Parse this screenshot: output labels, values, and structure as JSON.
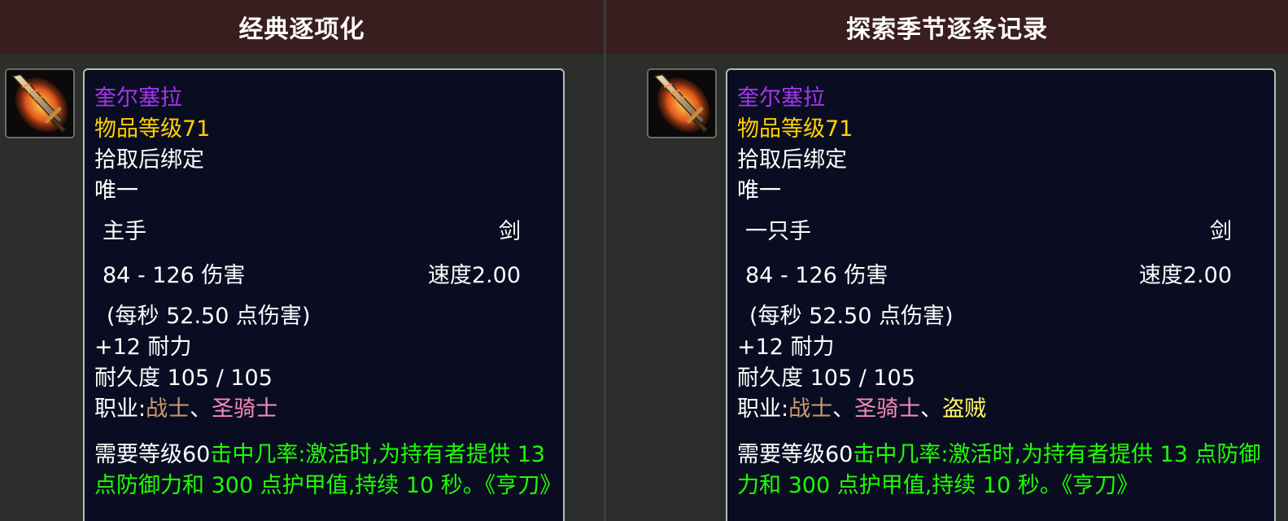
{
  "left": {
    "title": "经典逐项化",
    "item": {
      "name": "奎尔塞拉",
      "item_level": "物品等级71",
      "bind": "拾取后绑定",
      "unique": "唯一",
      "slot": "主手",
      "type": "剑",
      "damage": "84 - 126 伤害",
      "speed": "速度2.00",
      "dps": "(每秒 52.50 点伤害)",
      "stat": "+12 耐力",
      "durability": "耐久度 105 / 105",
      "classes_label": "职业:",
      "class_warrior": "战士",
      "sep1": "、",
      "class_paladin": "圣骑士",
      "req_level": "需要等级60",
      "effect": "击中几率:激活时,为持有者提供 13 点防御力和 300 点护甲值,持续 10 秒。《亨刀》"
    }
  },
  "right": {
    "title": "探索季节逐条记录",
    "item": {
      "name": "奎尔塞拉",
      "item_level": "物品等级71",
      "bind": "拾取后绑定",
      "unique": "唯一",
      "slot": "一只手",
      "type": "剑",
      "damage": "84 - 126 伤害",
      "speed": "速度2.00",
      "dps": "(每秒 52.50 点伤害)",
      "stat": "+12 耐力",
      "durability": "耐久度 105 / 105",
      "classes_label": "职业:",
      "class_warrior": "战士",
      "sep1": "、",
      "class_paladin": "圣骑士",
      "sep2": "、",
      "class_rogue": "盗贼",
      "req_level": "需要等级60",
      "effect": "击中几率:激活时,为持有者提供 13 点防御力和 300 点护甲值,持续 10 秒。《亨刀》"
    }
  },
  "colors": {
    "header_bg": "#3a1e1f",
    "tooltip_bg": "#0a0d21",
    "epic_purple": "#a335ee",
    "item_level_yellow": "#ffd100",
    "effect_green": "#1eff00",
    "warrior": "#c79c6e",
    "paladin": "#f58cba",
    "rogue": "#fff569"
  }
}
